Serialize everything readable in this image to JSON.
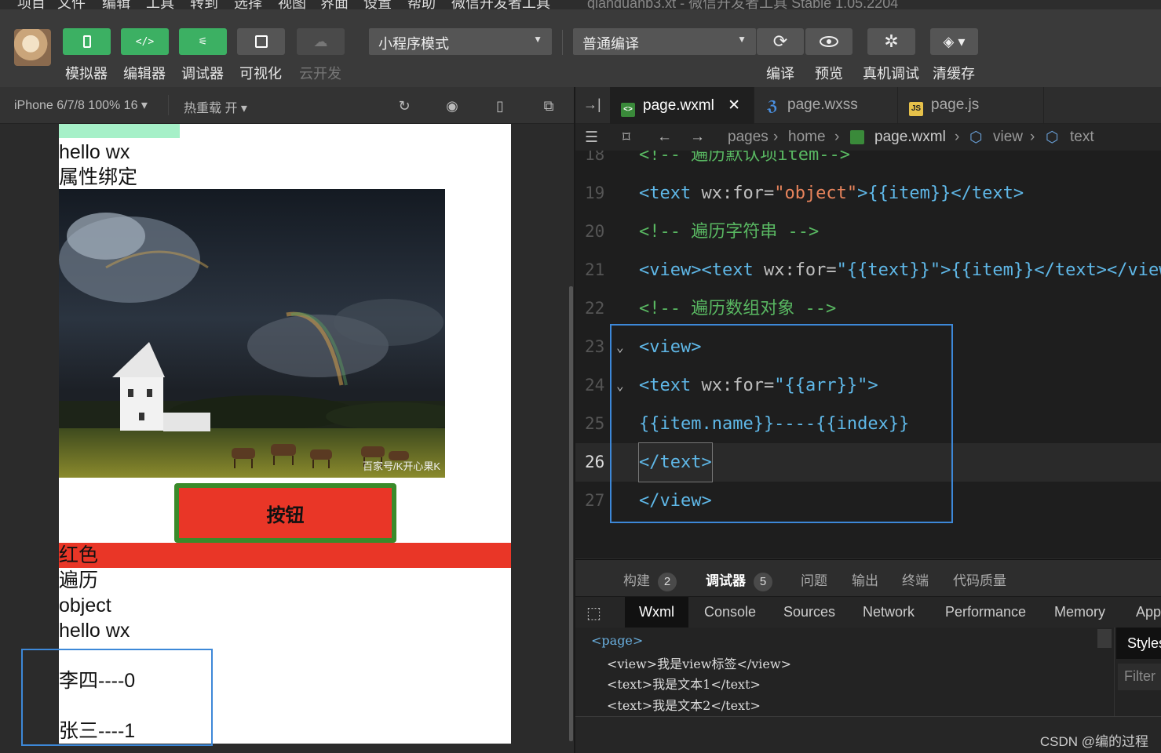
{
  "menubar": {
    "items": [
      "项目",
      "文件",
      "编辑",
      "工具",
      "转到",
      "选择",
      "视图",
      "界面",
      "设置",
      "帮助",
      "微信开发者工具"
    ],
    "title": "qianduanb3.xt - 微信开发者工具 Stable 1.05.2204"
  },
  "toolbar": {
    "buttons": [
      {
        "label": "模拟器",
        "icon": "phone-icon"
      },
      {
        "label": "编辑器",
        "icon": "code-icon"
      },
      {
        "label": "调试器",
        "icon": "debug-icon"
      },
      {
        "label": "可视化",
        "icon": "layout-icon"
      },
      {
        "label": "云开发",
        "icon": "cloud-icon"
      }
    ],
    "mode_select": "小程序模式",
    "compile_select": "普通编译",
    "actions": [
      {
        "label": "编译",
        "icon": "refresh-icon"
      },
      {
        "label": "预览",
        "icon": "eye-icon"
      },
      {
        "label": "真机调试",
        "icon": "bug-icon"
      },
      {
        "label": "清缓存",
        "icon": "layers-icon"
      }
    ]
  },
  "simulator": {
    "device": "iPhone 6/7/8 100% 16 ▾",
    "hot_reload": "热重载 开 ▾",
    "lines": [
      "hello wx",
      "属性绑定"
    ],
    "photo_caption": "百家号/K开心果K",
    "button_label": "按钮",
    "red_text": "红色",
    "lines_after": [
      "遍历",
      "object",
      "hello wx"
    ],
    "list_items": [
      "李四----0",
      "张三----1"
    ]
  },
  "editor": {
    "tabs": [
      {
        "label": "page.wxml",
        "active": true,
        "icon": "wxml-icon"
      },
      {
        "label": "page.wxss",
        "active": false,
        "icon": "wxss-icon"
      },
      {
        "label": "page.js",
        "active": false,
        "icon": "js-icon"
      }
    ],
    "breadcrumb": [
      "pages",
      "home",
      "page.wxml",
      "view",
      "text"
    ],
    "lines": [
      {
        "n": "18",
        "html": "&lt;!-- 遍历默认项item--&gt;"
      },
      {
        "n": "19",
        "text": "<text wx:for=\"object\">{{item}}</text>"
      },
      {
        "n": "20",
        "text": "<!-- 遍历字符串 -->"
      },
      {
        "n": "21",
        "text": "<view><text wx:for=\"{{text}}\">{{item}}</text></view>"
      },
      {
        "n": "22",
        "text": "<!-- 遍历数组对象 -->"
      },
      {
        "n": "23",
        "text": "<view>"
      },
      {
        "n": "24",
        "text": "<text wx:for=\"{{arr}}\">"
      },
      {
        "n": "25",
        "text": "{{item.name}}----{{index}}"
      },
      {
        "n": "26",
        "text": "</text>"
      },
      {
        "n": "27",
        "text": "</view>"
      }
    ]
  },
  "bottom_panel": {
    "tabs": [
      {
        "label": "构建",
        "badge": "2"
      },
      {
        "label": "调试器",
        "badge": "5"
      },
      {
        "label": "问题"
      },
      {
        "label": "输出"
      },
      {
        "label": "终端"
      },
      {
        "label": "代码质量"
      }
    ],
    "devtools_tabs": [
      "Wxml",
      "Console",
      "Sources",
      "Network",
      "Performance",
      "Memory",
      "App"
    ],
    "wxml_tree": [
      "<page>",
      "<view>我是view标签</view>",
      "<text>我是文本1</text>",
      "<text>我是文本2</text>"
    ],
    "styles_tab": "Styles",
    "filter_placeholder": "Filter"
  },
  "watermark": "CSDN @编的过程",
  "colors": {
    "accent_green": "#3cb063",
    "highlight_blue": "#3d88d8",
    "red": "#e93627"
  }
}
